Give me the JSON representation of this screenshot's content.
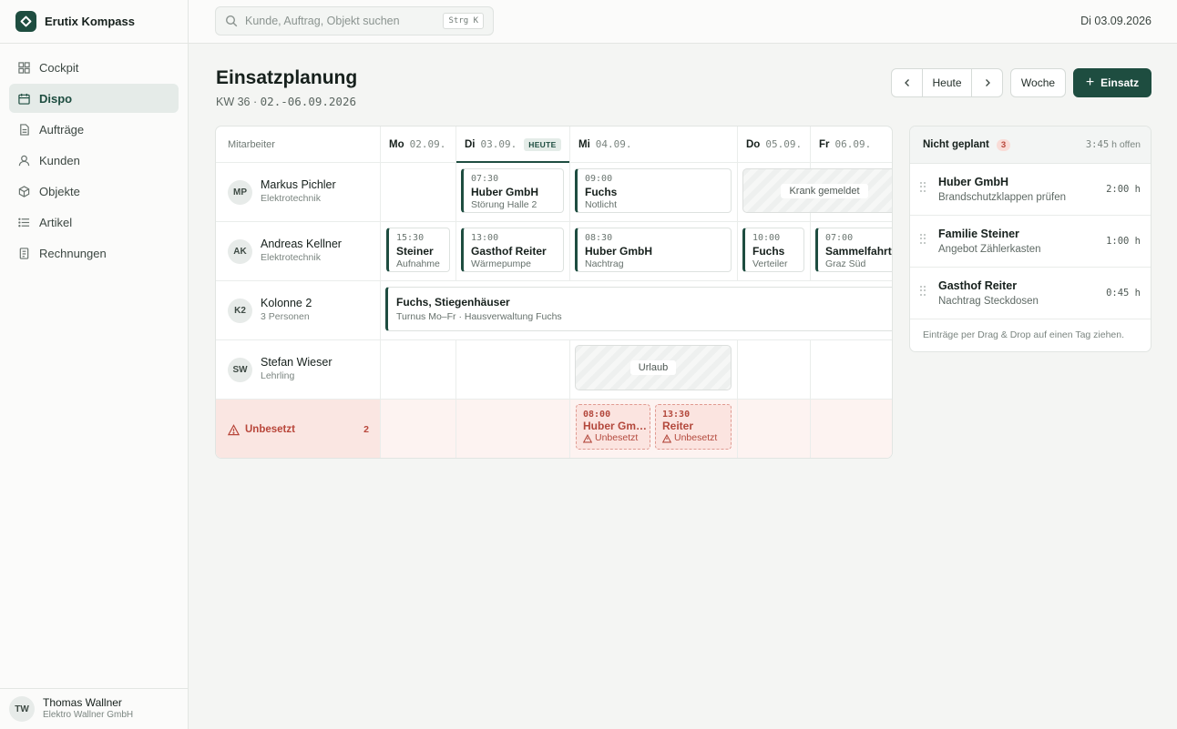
{
  "app": {
    "name": "Erutix Kompass"
  },
  "sidebar": {
    "items": [
      {
        "label": "Cockpit",
        "icon": "grid-icon"
      },
      {
        "label": "Dispo",
        "icon": "calendar-icon",
        "active": true
      },
      {
        "label": "Aufträge",
        "icon": "document-icon"
      },
      {
        "label": "Kunden",
        "icon": "user-icon"
      },
      {
        "label": "Objekte",
        "icon": "cube-icon"
      },
      {
        "label": "Artikel",
        "icon": "list-icon"
      },
      {
        "label": "Rechnungen",
        "icon": "receipt-icon"
      }
    ],
    "user": {
      "initials": "TW",
      "name": "Thomas Wallner",
      "org": "Elektro Wallner GmbH"
    }
  },
  "topbar": {
    "search_placeholder": "Kunde, Auftrag, Objekt suchen",
    "search_shortcut": "Strg K",
    "date": "Di 03.09.2026"
  },
  "page": {
    "title": "Einsatzplanung",
    "week_prefix": "KW 36 ·",
    "week_range": "02.-06.09.2026"
  },
  "toolbar": {
    "prev": "‹",
    "today": "Heute",
    "next": "›",
    "week": "Woche",
    "add_label": "Einsatz",
    "add_icon": "+"
  },
  "schedule": {
    "employee_header": "Mitarbeiter",
    "today_badge": "HEUTE",
    "days": [
      {
        "day": "Mo",
        "date": "02.09."
      },
      {
        "day": "Di",
        "date": "03.09.",
        "today": true
      },
      {
        "day": "Mi",
        "date": "04.09."
      },
      {
        "day": "Do",
        "date": "05.09."
      },
      {
        "day": "Fr",
        "date": "06.09."
      }
    ],
    "employees": [
      {
        "initials": "MP",
        "name": "Markus Pichler",
        "role": "Elektrotechnik"
      },
      {
        "initials": "AK",
        "name": "Andreas Kellner",
        "role": "Elektrotechnik"
      },
      {
        "initials": "K2",
        "name": "Kolonne 2",
        "role": "3 Personen"
      },
      {
        "initials": "SW",
        "name": "Stefan Wieser",
        "role": "Lehrling"
      }
    ],
    "jobs": [
      {
        "time": "07:30",
        "name": "Huber GmbH",
        "sub": "Störung Halle 2"
      },
      {
        "time": "09:00",
        "name": "Fuchs",
        "sub": "Notlicht"
      },
      {
        "time": "15:30",
        "name": "Steiner",
        "sub": "Aufnahme"
      },
      {
        "time": "13:00",
        "name": "Gasthof Reiter",
        "sub": "Wärmepumpe"
      },
      {
        "time": "08:30",
        "name": "Huber GmbH",
        "sub": "Nachtrag"
      },
      {
        "time": "10:00",
        "name": "Fuchs",
        "sub": "Verteiler"
      },
      {
        "time": "07:00",
        "name": "Sammelfahrt",
        "sub": "Graz Süd"
      }
    ],
    "absences": {
      "sick": "Krank gemeldet",
      "vacation": "Urlaub"
    },
    "series": {
      "name": "Fuchs, Stiegenhäuser",
      "sub": "Turnus Mo–Fr · Hausverwaltung Fuchs"
    },
    "unassigned": {
      "label": "Unbesetzt",
      "count": "2",
      "jobs": [
        {
          "time": "08:00",
          "name": "Huber GmbH",
          "status": "Unbesetzt"
        },
        {
          "time": "13:30",
          "name": "Reiter",
          "status": "Unbesetzt"
        }
      ]
    }
  },
  "unplanned": {
    "title": "Nicht geplant",
    "count": "3",
    "open_value": "3:45",
    "open_suffix": "h offen",
    "items": [
      {
        "name": "Huber GmbH",
        "sub": "Brandschutzklappen prüfen",
        "duration": "2:00 h"
      },
      {
        "name": "Familie Steiner",
        "sub": "Angebot Zählerkasten",
        "duration": "1:00 h"
      },
      {
        "name": "Gasthof Reiter",
        "sub": "Nachtrag Steckdosen",
        "duration": "0:45 h"
      }
    ],
    "hint": "Einträge per Drag & Drop auf einen Tag ziehen."
  },
  "colors": {
    "accent": "#1e4d40",
    "danger": "#b8463a"
  }
}
